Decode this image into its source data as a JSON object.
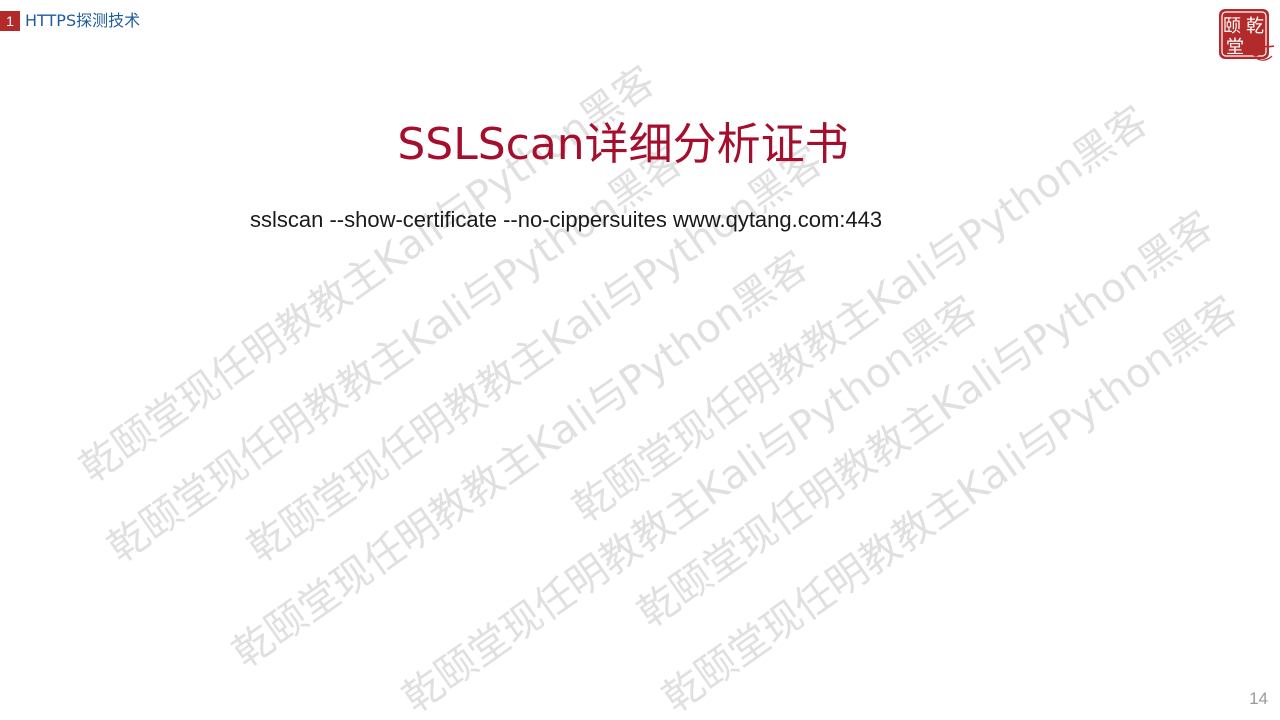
{
  "header": {
    "section_number": "1",
    "section_title": "HTTPS探测技术",
    "logo_text": [
      "颐",
      "乾",
      "堂"
    ]
  },
  "slide": {
    "title": "SSLScan详细分析证书",
    "command": "sslscan --show-certificate --no-cippersuites www.qytang.com:443",
    "page_number": "14"
  },
  "watermark": {
    "text": "乾颐堂现任明教教主Kali与Python黑客",
    "color": "#c8c8c8"
  },
  "colors": {
    "title": "#a50f2d",
    "section_badge": "#b22a2a",
    "section_label": "#1f5c9e",
    "seal": "#b22a2a"
  }
}
